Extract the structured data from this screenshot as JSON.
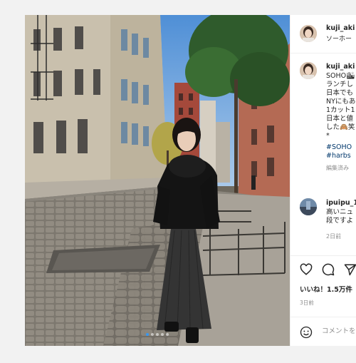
{
  "header": {
    "username": "kuji_aki",
    "location": "ソーホー"
  },
  "caption": {
    "username": "kuji_aki",
    "lines": [
      "SOHO🏙",
      "ランチし",
      "日本でも",
      "NYにもあ",
      "1カット1",
      "日本と値",
      "した🙈笑",
      "*"
    ],
    "hashtags": [
      "#SOHO",
      "#harbs"
    ],
    "edited": "編集済み"
  },
  "comment": {
    "username": "ipuipu_1",
    "lines": [
      "高いニュ",
      "段ですよ"
    ],
    "time": "2日前"
  },
  "stats": {
    "likes": "いいね！1.5万件",
    "date": "3日前"
  },
  "add_comment": {
    "placeholder": "コメントを"
  },
  "carousel": {
    "slide_count": 5,
    "active_index": 0
  },
  "icons": {
    "like": "heart-icon",
    "comment": "comment-icon",
    "share": "share-icon",
    "emoji": "emoji-icon",
    "next": "chevron-right-icon"
  },
  "colors": {
    "link": "#00376b",
    "active_dot": "#3897f0",
    "muted": "#8e8e8e"
  }
}
